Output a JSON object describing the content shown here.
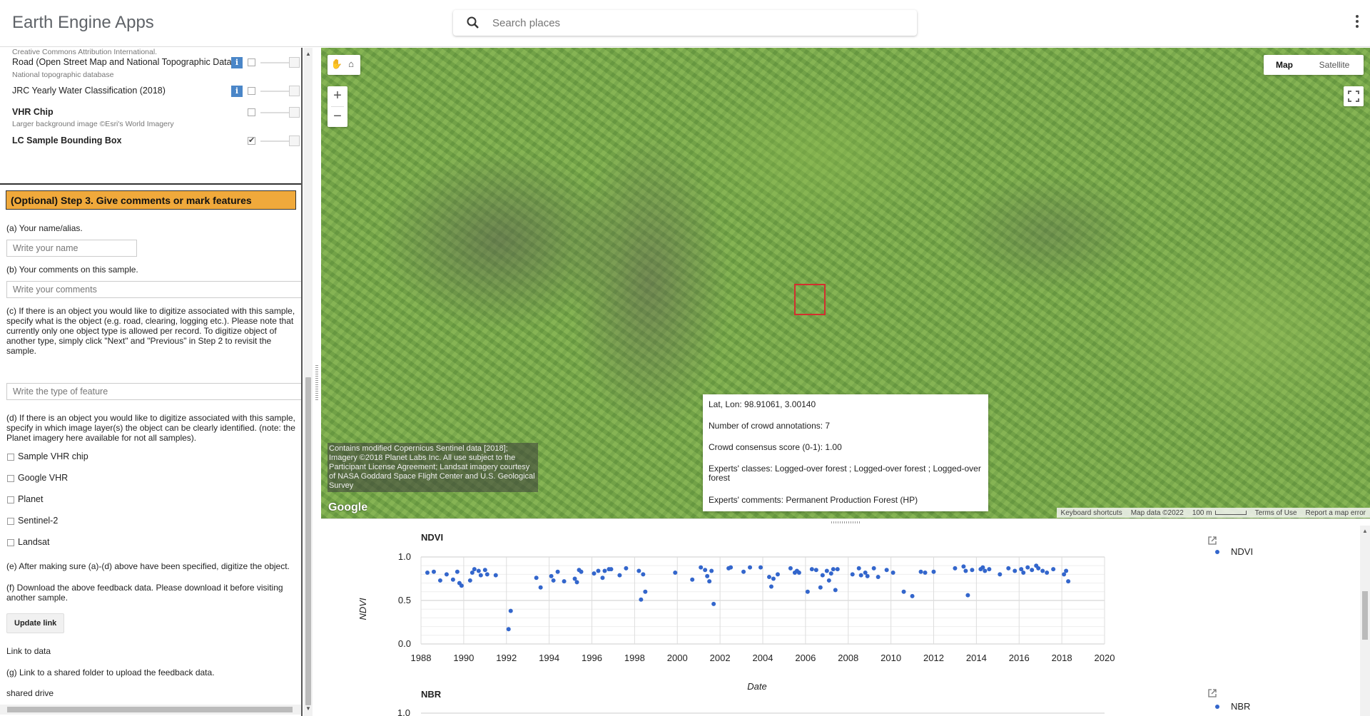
{
  "header": {
    "app_title": "Earth Engine Apps",
    "search_placeholder": "Search places"
  },
  "layers": {
    "top_note": "Creative Commons Attribution International.",
    "items": [
      {
        "label": "Road (Open Street Map and National Topographic Databa",
        "note": "National topographic database",
        "checked": false,
        "bold": false,
        "info": true
      },
      {
        "label": "JRC Yearly Water Classification (2018)",
        "note": "",
        "checked": false,
        "bold": false,
        "info": true
      },
      {
        "label": "VHR Chip",
        "note": "Larger background image ©Esri's World Imagery",
        "checked": false,
        "bold": true,
        "info": false
      },
      {
        "label": "LC Sample Bounding Box",
        "note": "",
        "checked": true,
        "bold": true,
        "info": false
      }
    ]
  },
  "step3": {
    "header": "(Optional) Step 3. Give comments or mark features",
    "q_a": "(a) Your name/alias.",
    "name_placeholder": "Write your name",
    "q_b": "(b) Your comments on this sample.",
    "comments_placeholder": "Write your comments",
    "q_c": "(c) If there is an object you would like to digitize associated with this sample, specify what is the object (e.g. road, clearing, logging etc.). Please note that currently only one object type is allowed per record. To digitize object of another type, simply click \"Next\" and \"Previous\" in Step 2 to revisit the sample.",
    "feature_placeholder": "Write the type of feature",
    "q_d": "(d) If there is an object you would like to digitize associated with this sample, specify in which image layer(s) the object can be clearly identified. (note: the Planet imagery here available for not all samples).",
    "layer_options": [
      "Sample VHR chip",
      "Google VHR",
      "Planet",
      "Sentinel-2",
      "Landsat"
    ],
    "q_e": "(e) After making sure (a)-(d) above have been specified, digitize the object.",
    "q_f": "(f) Download the above feedback data. Please download it before visiting another sample.",
    "update_button": "Update link",
    "link_text": "Link to data",
    "q_g": "(g) Link to a shared folder to upload the feedback data.",
    "shared_drive": "shared drive"
  },
  "map": {
    "map_type_options": [
      "Map",
      "Satellite"
    ],
    "selected_map_type": "Map",
    "zoom_in": "+",
    "zoom_out": "−",
    "attribution": "Contains modified Copernicus Sentinel data [2018]; Imagery ©2018 Planet Labs Inc. All use subject to the Participant License Agreement; Landsat imagery courtesy of NASA Goddard Space Flight Center and U.S. Geological Survey",
    "google_logo": "Google",
    "footer": {
      "shortcuts": "Keyboard shortcuts",
      "map_data": "Map data ©2022",
      "scale": "100 m",
      "terms": "Terms of Use",
      "report": "Report a map error"
    },
    "popup": {
      "latlon": "Lat, Lon: 98.91061, 3.00140",
      "annotations": "Number of crowd annotations: 7",
      "consensus": "Crowd consensus score (0-1): 1.00",
      "experts_classes": "Experts' classes: Logged-over forest ; Logged-over forest ; Logged-over forest",
      "experts_comments": "Experts' comments: Permanent Production Forest (HP)"
    }
  },
  "chart_data": [
    {
      "type": "scatter",
      "title": "NDVI",
      "xlabel": "Date",
      "ylabel": "NDVI",
      "legend": "top-right",
      "series": [
        {
          "name": "NDVI",
          "color": "#3366cc",
          "points": [
            [
              1988.3,
              0.82
            ],
            [
              1988.6,
              0.83
            ],
            [
              1988.9,
              0.73
            ],
            [
              1989.2,
              0.8
            ],
            [
              1989.5,
              0.74
            ],
            [
              1989.7,
              0.83
            ],
            [
              1989.8,
              0.7
            ],
            [
              1989.9,
              0.67
            ],
            [
              1990.3,
              0.73
            ],
            [
              1990.4,
              0.82
            ],
            [
              1990.5,
              0.86
            ],
            [
              1990.7,
              0.84
            ],
            [
              1990.8,
              0.79
            ],
            [
              1991.0,
              0.85
            ],
            [
              1991.1,
              0.8
            ],
            [
              1991.5,
              0.79
            ],
            [
              1992.1,
              0.17
            ],
            [
              1992.2,
              0.38
            ],
            [
              1993.4,
              0.76
            ],
            [
              1993.6,
              0.65
            ],
            [
              1994.1,
              0.78
            ],
            [
              1994.2,
              0.73
            ],
            [
              1994.4,
              0.83
            ],
            [
              1994.7,
              0.72
            ],
            [
              1995.2,
              0.75
            ],
            [
              1995.3,
              0.71
            ],
            [
              1995.4,
              0.85
            ],
            [
              1995.5,
              0.83
            ],
            [
              1996.1,
              0.81
            ],
            [
              1996.3,
              0.84
            ],
            [
              1996.5,
              0.76
            ],
            [
              1996.6,
              0.84
            ],
            [
              1996.8,
              0.86
            ],
            [
              1996.9,
              0.86
            ],
            [
              1997.3,
              0.79
            ],
            [
              1997.6,
              0.87
            ],
            [
              1998.2,
              0.84
            ],
            [
              1998.3,
              0.51
            ],
            [
              1998.4,
              0.8
            ],
            [
              1998.5,
              0.6
            ],
            [
              1999.9,
              0.82
            ],
            [
              2000.7,
              0.74
            ],
            [
              2001.1,
              0.88
            ],
            [
              2001.3,
              0.85
            ],
            [
              2001.4,
              0.78
            ],
            [
              2001.5,
              0.72
            ],
            [
              2001.6,
              0.84
            ],
            [
              2001.7,
              0.46
            ],
            [
              2002.4,
              0.87
            ],
            [
              2002.5,
              0.88
            ],
            [
              2003.1,
              0.83
            ],
            [
              2003.4,
              0.88
            ],
            [
              2003.9,
              0.88
            ],
            [
              2004.3,
              0.77
            ],
            [
              2004.4,
              0.66
            ],
            [
              2004.5,
              0.75
            ],
            [
              2004.7,
              0.8
            ],
            [
              2005.3,
              0.87
            ],
            [
              2005.5,
              0.82
            ],
            [
              2005.6,
              0.84
            ],
            [
              2005.7,
              0.82
            ],
            [
              2006.1,
              0.6
            ],
            [
              2006.3,
              0.86
            ],
            [
              2006.5,
              0.85
            ],
            [
              2006.7,
              0.65
            ],
            [
              2006.8,
              0.79
            ],
            [
              2007.0,
              0.84
            ],
            [
              2007.1,
              0.73
            ],
            [
              2007.2,
              0.81
            ],
            [
              2007.3,
              0.86
            ],
            [
              2007.4,
              0.62
            ],
            [
              2007.5,
              0.86
            ],
            [
              2008.2,
              0.8
            ],
            [
              2008.5,
              0.87
            ],
            [
              2008.6,
              0.79
            ],
            [
              2008.8,
              0.82
            ],
            [
              2008.9,
              0.78
            ],
            [
              2009.2,
              0.87
            ],
            [
              2009.4,
              0.77
            ],
            [
              2009.8,
              0.85
            ],
            [
              2010.1,
              0.82
            ],
            [
              2010.6,
              0.6
            ],
            [
              2011.0,
              0.55
            ],
            [
              2011.4,
              0.83
            ],
            [
              2011.6,
              0.82
            ],
            [
              2012.0,
              0.83
            ],
            [
              2013.0,
              0.87
            ],
            [
              2013.4,
              0.89
            ],
            [
              2013.5,
              0.84
            ],
            [
              2013.6,
              0.56
            ],
            [
              2013.8,
              0.85
            ],
            [
              2014.2,
              0.86
            ],
            [
              2014.3,
              0.88
            ],
            [
              2014.4,
              0.84
            ],
            [
              2014.6,
              0.86
            ],
            [
              2015.1,
              0.8
            ],
            [
              2015.5,
              0.87
            ],
            [
              2015.8,
              0.84
            ],
            [
              2016.1,
              0.86
            ],
            [
              2016.2,
              0.82
            ],
            [
              2016.4,
              0.88
            ],
            [
              2016.6,
              0.85
            ],
            [
              2016.8,
              0.9
            ],
            [
              2016.9,
              0.87
            ],
            [
              2017.1,
              0.84
            ],
            [
              2017.3,
              0.82
            ],
            [
              2017.6,
              0.86
            ],
            [
              2018.1,
              0.8
            ],
            [
              2018.2,
              0.84
            ],
            [
              2018.3,
              0.72
            ]
          ]
        }
      ],
      "x_ticks": [
        "1988",
        "1990",
        "1992",
        "1994",
        "1996",
        "1998",
        "2000",
        "2002",
        "2004",
        "2006",
        "2008",
        "2010",
        "2012",
        "2014",
        "2016",
        "2018",
        "2020"
      ],
      "y_ticks": [
        "0.0",
        "0.5",
        "1.0"
      ],
      "xlim": [
        1988,
        2020
      ],
      "ylim": [
        0.0,
        1.0
      ]
    },
    {
      "type": "scatter",
      "title": "NBR",
      "legend": "top-right",
      "series": [
        {
          "name": "NBR",
          "color": "#3366cc",
          "points": []
        }
      ],
      "y_ticks": [
        "1.0"
      ]
    }
  ]
}
